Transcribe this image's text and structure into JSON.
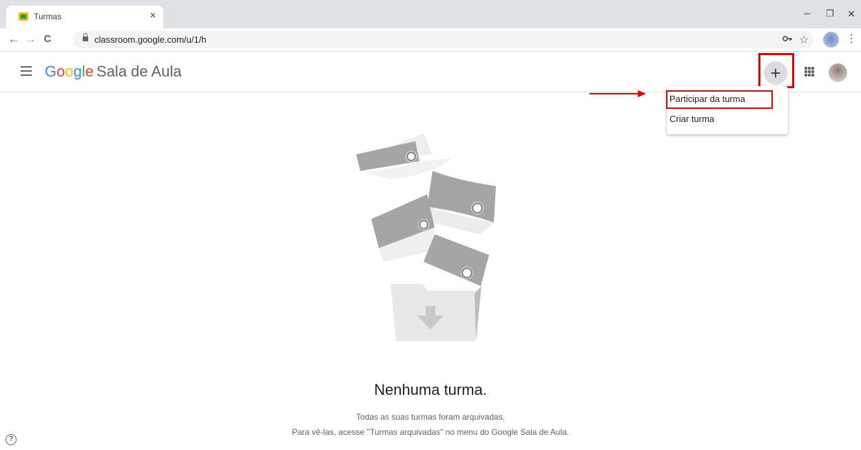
{
  "browser": {
    "tab_title": "Turmas",
    "tab_close": "×",
    "url": "classroom.google.com/u/1/h",
    "window_controls": {
      "minimize": "–",
      "restore": "❐",
      "close": "✕"
    },
    "nav": {
      "back": "←",
      "forward": "→",
      "reload": "C"
    },
    "icons": [
      "lock-icon",
      "key-icon",
      "star-icon",
      "profile-icon",
      "kebab-menu-icon"
    ]
  },
  "header": {
    "brand_google": [
      "G",
      "o",
      "o",
      "g",
      "l",
      "e"
    ],
    "brand_colors": [
      "#4285F4",
      "#EA4335",
      "#FBBC05",
      "#4285F4",
      "#34A853",
      "#EA4335"
    ],
    "brand_name": "Sala de Aula",
    "plus_label": "+",
    "icons": [
      "hamburger-icon",
      "plus-icon",
      "apps-grid-icon",
      "avatar"
    ]
  },
  "menu": {
    "items": [
      {
        "label": "Participar da turma"
      },
      {
        "label": "Criar turma"
      }
    ]
  },
  "annotations": {
    "highlight_color": "#e60000"
  },
  "empty_state": {
    "title": "Nenhuma turma.",
    "line1": "Todas as suas turmas foram arquivadas.",
    "line2": "Para vê-las, acesse \"Turmas arquivadas\" no menu do Google Sala de Aula."
  },
  "help": {
    "label": "?"
  }
}
